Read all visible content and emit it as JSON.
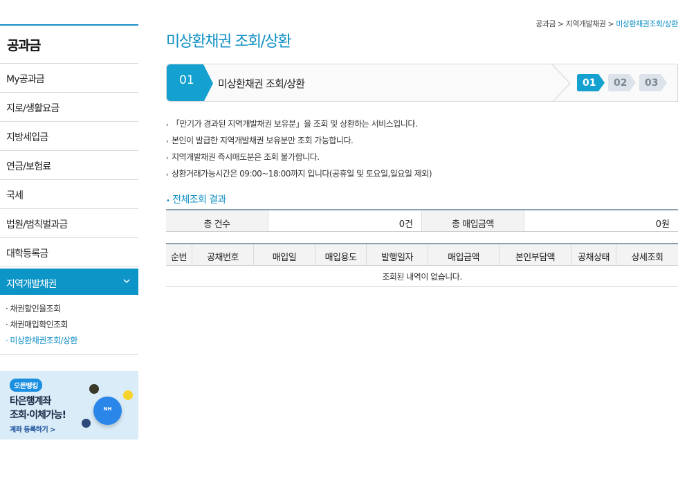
{
  "breadcrumb": {
    "items": [
      "공과금",
      "지역개발채권"
    ],
    "current": "미상환채권조회/상환",
    "sep": " > "
  },
  "page_title": "미상환채권 조회/상환",
  "sidebar": {
    "title": "공과금",
    "items": [
      {
        "label": "My공과금"
      },
      {
        "label": "지로/생활요금"
      },
      {
        "label": "지방세입금"
      },
      {
        "label": "연금/보험료"
      },
      {
        "label": "국세"
      },
      {
        "label": "법원/범칙벌과금"
      },
      {
        "label": "대학등록금"
      }
    ],
    "active": {
      "label": "지역개발채권",
      "icon": "chevron-down-icon"
    },
    "submenu": [
      "· 채권할인율조회",
      "· 채권매입확인조회",
      "· 미상환채권조회/상환"
    ]
  },
  "banner": {
    "badge": "오픈뱅킹",
    "line1": "타은행계좌",
    "line2": "조회·이체가능!",
    "link": "계좌 등록하기 >",
    "logo": "NH"
  },
  "step": {
    "number": "01",
    "label": "미상환채권 조회/상환",
    "steps": [
      "01",
      "02",
      "03"
    ],
    "active_color": "#14a1cf",
    "inactive_color": "#dde3ea"
  },
  "notices": [
    "「만기가 경과된 지역개발채권 보유분」을 조회 및 상환하는 서비스입니다.",
    "본인이 발급한 지역개발채권 보유분만 조회 가능합니다.",
    "지역개발채권 즉시매도분은 조회 불가합니다.",
    "상환거래가능시간은 09:00~18:00까지 입니다(공휴일 및 토요일,일요일 제외)"
  ],
  "section_title": "전체조회 결과",
  "summary": {
    "count_label": "총 건수",
    "count_value": "0건",
    "amount_label": "총 매입금액",
    "amount_value": "0원"
  },
  "table": {
    "headers": [
      "순번",
      "공채번호",
      "매입일",
      "매입용도",
      "발행일자",
      "매입금액",
      "본인부담액",
      "공채상태",
      "상세조회"
    ],
    "empty_message": "조회된 내역이 없습니다."
  }
}
